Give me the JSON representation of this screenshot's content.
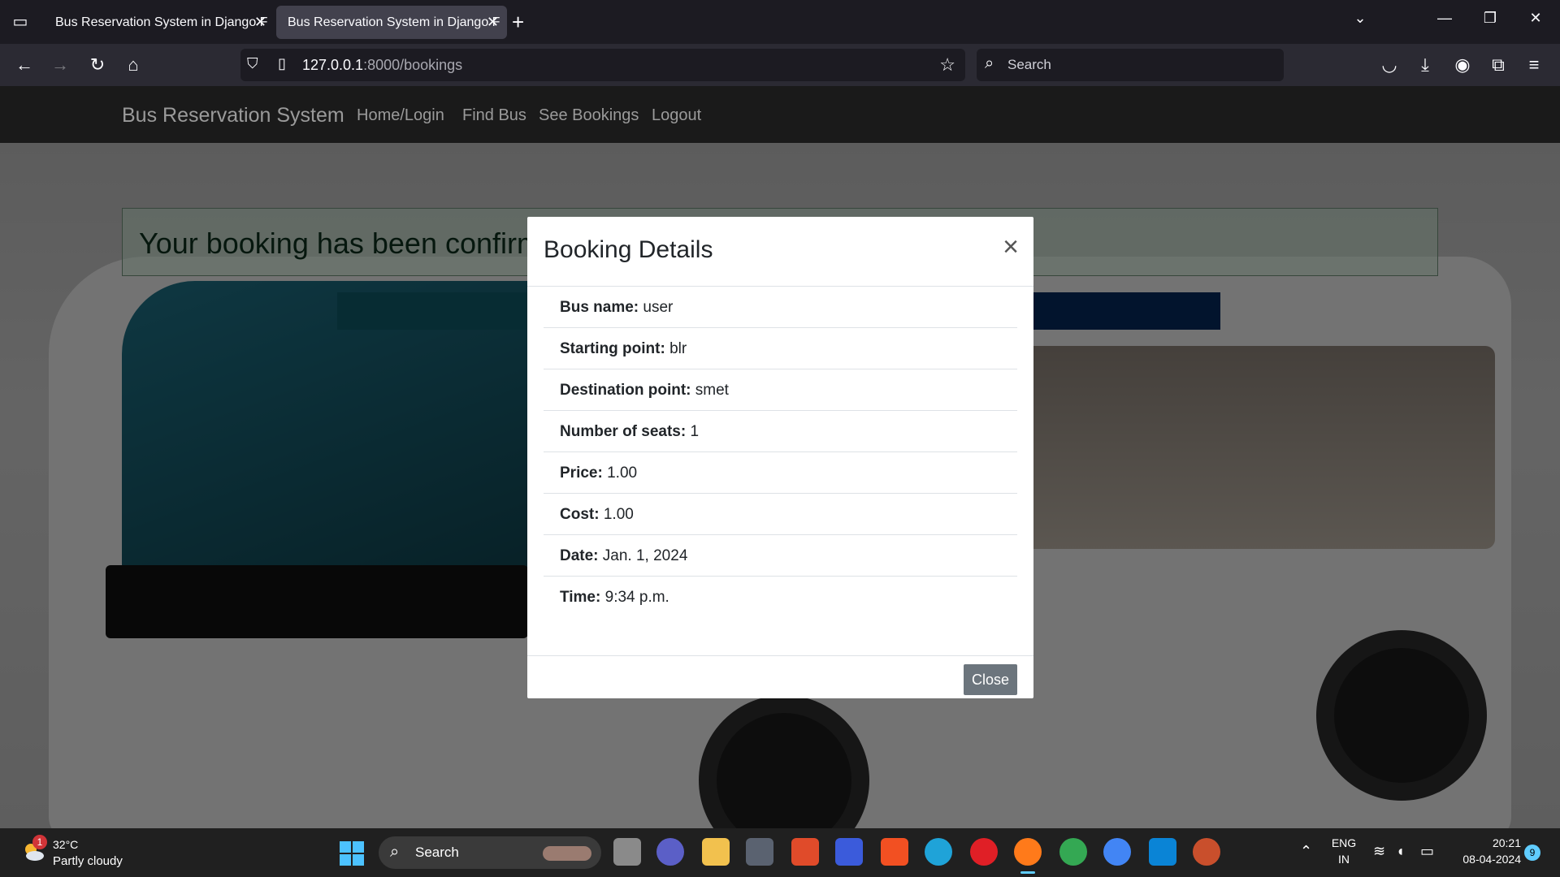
{
  "browser": {
    "tabs": [
      {
        "title": "Bus Reservation System in Django F"
      },
      {
        "title": "Bus Reservation System in Django F"
      }
    ],
    "url_host": "127.0.0.1",
    "url_rest": ":8000/bookings",
    "search_placeholder": "Search"
  },
  "site": {
    "brand": "Bus Reservation System",
    "nav": [
      "Home/Login",
      "Find Bus",
      "See Bookings",
      "Logout"
    ],
    "alert": "Your booking has been confirm"
  },
  "modal": {
    "title": "Booking Details",
    "rows": [
      {
        "label": "Bus name:",
        "value": "user"
      },
      {
        "label": "Starting point:",
        "value": "blr"
      },
      {
        "label": "Destination point:",
        "value": "smet"
      },
      {
        "label": "Number of seats:",
        "value": "1"
      },
      {
        "label": "Price:",
        "value": "1.00"
      },
      {
        "label": "Cost:",
        "value": "1.00"
      },
      {
        "label": "Date:",
        "value": "Jan. 1, 2024"
      },
      {
        "label": "Time:",
        "value": "9:34 p.m."
      }
    ],
    "close_label": "Close",
    "close_symbol": "×"
  },
  "taskbar": {
    "weather_temp": "32°C",
    "weather_desc": "Partly cloudy",
    "weather_badge": "1",
    "search_label": "Search",
    "lang_line1": "ENG",
    "lang_line2": "IN",
    "time": "20:21",
    "date": "08-04-2024",
    "notification_count": "9"
  },
  "colors": {
    "accent_blue": "#60cdff",
    "modal_button": "#6c757d",
    "alert_text": "#0d2f1c"
  }
}
